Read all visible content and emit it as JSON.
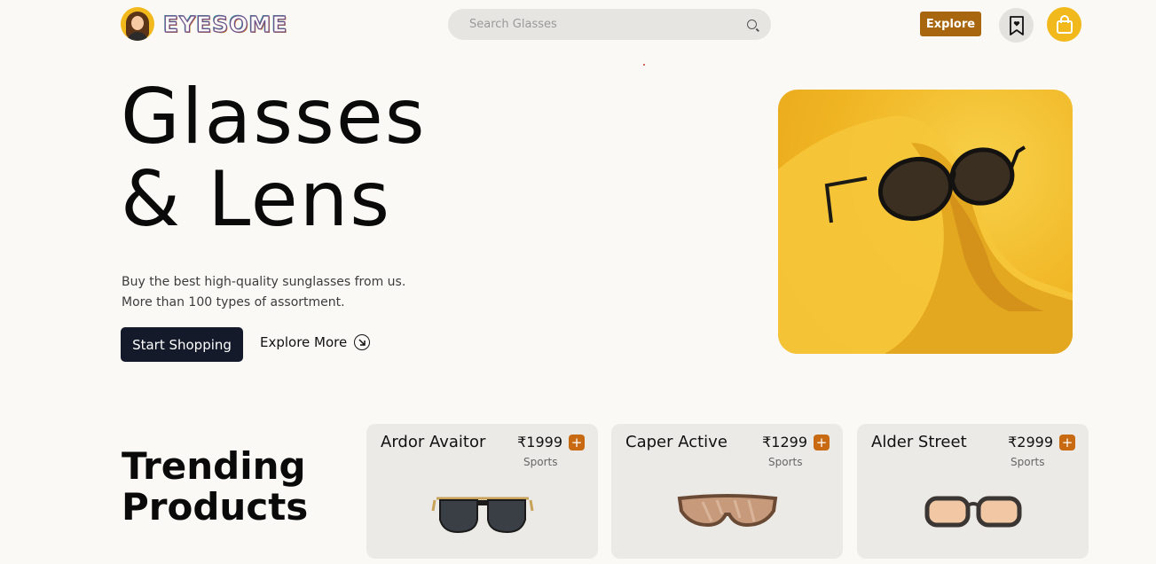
{
  "header": {
    "logo_text": "EYESOME",
    "search_placeholder": "Search Glasses",
    "explore_label": "Explore"
  },
  "hero": {
    "title_line1": "Glasses",
    "title_line2": "& Lens",
    "subtitle_line1": "Buy the best high-quality sunglasses from us.",
    "subtitle_line2": "More than 100 types of assortment.",
    "cta_primary": "Start Shopping",
    "cta_secondary": "Explore More"
  },
  "trending": {
    "title_line1": "Trending",
    "title_line2": "Products",
    "products": [
      {
        "name": "Ardor Avaitor",
        "price": "₹1999",
        "category": "Sports",
        "add_label": "+"
      },
      {
        "name": "Caper Active",
        "price": "₹1299",
        "category": "Sports",
        "add_label": "+"
      },
      {
        "name": "Alder Street",
        "price": "₹2999",
        "category": "Sports",
        "add_label": "+"
      }
    ]
  },
  "colors": {
    "accent_brown": "#a8660e",
    "accent_yellow": "#f2b91c",
    "dark_button": "#141a29",
    "card_bg": "#ebeae6"
  },
  "icons": [
    "search-icon",
    "bookmark-heart-icon",
    "shopping-bag-icon",
    "arrow-down-right-icon",
    "plus-icon"
  ]
}
